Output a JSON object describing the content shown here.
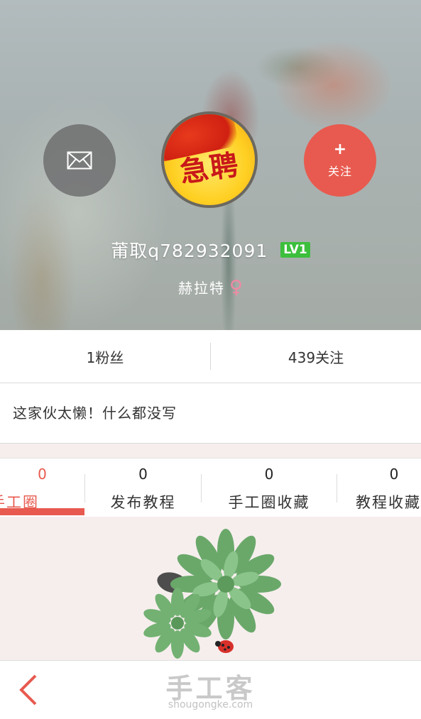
{
  "profile": {
    "username": "莆取q782932091",
    "level": "LV1",
    "subtitle": "赫拉特",
    "gender_symbol": "♀",
    "avatar_text": "急聘"
  },
  "actions": {
    "message_icon": "envelope-icon",
    "follow_plus": "+",
    "follow_label": "关注"
  },
  "stats": {
    "fans": "1粉丝",
    "following": "439关注"
  },
  "bio": "这家伙太懒！什么都没写",
  "tabs": [
    {
      "count": "0",
      "label": "手工圈",
      "active": true
    },
    {
      "count": "0",
      "label": "发布教程",
      "active": false
    },
    {
      "count": "0",
      "label": "手工圈收藏",
      "active": false
    },
    {
      "count": "0",
      "label": "教程收藏",
      "active": false
    }
  ],
  "bottom_bar": {
    "back_icon": "chevron-left-icon",
    "brand_name": "手工客",
    "brand_url": "shougongke.com"
  },
  "colors": {
    "accent": "#e85a4f",
    "level_badge": "#3cbf3c",
    "gender": "#f08aa4"
  }
}
